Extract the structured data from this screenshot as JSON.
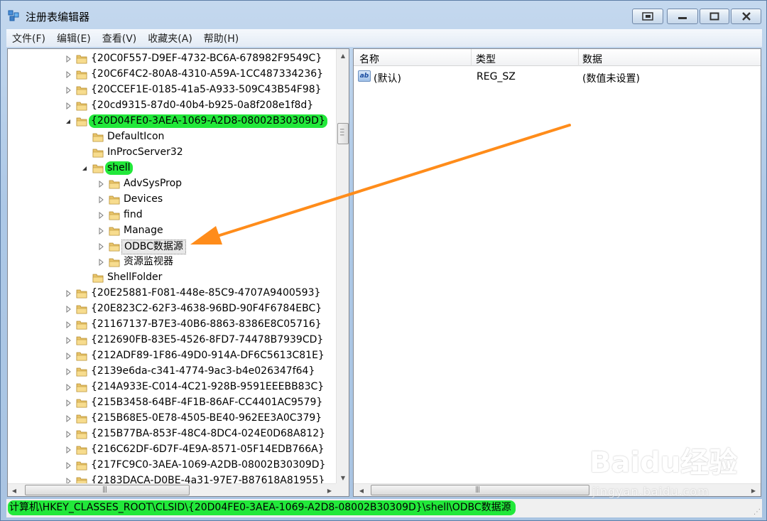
{
  "window": {
    "title": "注册表编辑器"
  },
  "menu": [
    "文件(F)",
    "编辑(E)",
    "查看(V)",
    "收藏夹(A)",
    "帮助(H)"
  ],
  "tree": {
    "rows": [
      {
        "label": "{20C0F557-D9EF-4732-BC6A-678982F9549C}",
        "level": 0,
        "state": "collapsed",
        "highlight": false,
        "selected": false
      },
      {
        "label": "{20C6F4C2-80A8-4310-A59A-1CC487334236}",
        "level": 0,
        "state": "collapsed",
        "highlight": false,
        "selected": false
      },
      {
        "label": "{20CCEF1E-0185-41a5-A933-509C43B54F98}",
        "level": 0,
        "state": "collapsed",
        "highlight": false,
        "selected": false
      },
      {
        "label": "{20cd9315-87d0-40b4-b925-0a8f208e1f8d}",
        "level": 0,
        "state": "collapsed",
        "highlight": false,
        "selected": false
      },
      {
        "label": "{20D04FE0-3AEA-1069-A2D8-08002B30309D}",
        "level": 0,
        "state": "expanded",
        "highlight": true,
        "selected": false
      },
      {
        "label": "DefaultIcon",
        "level": 1,
        "state": "none",
        "highlight": false,
        "selected": false
      },
      {
        "label": "InProcServer32",
        "level": 1,
        "state": "none",
        "highlight": false,
        "selected": false
      },
      {
        "label": "shell",
        "level": 1,
        "state": "expanded",
        "highlight": true,
        "selected": false
      },
      {
        "label": "AdvSysProp",
        "level": 2,
        "state": "collapsed",
        "highlight": false,
        "selected": false
      },
      {
        "label": "Devices",
        "level": 2,
        "state": "collapsed",
        "highlight": false,
        "selected": false
      },
      {
        "label": "find",
        "level": 2,
        "state": "collapsed",
        "highlight": false,
        "selected": false
      },
      {
        "label": "Manage",
        "level": 2,
        "state": "collapsed",
        "highlight": false,
        "selected": false
      },
      {
        "label": "ODBC数据源",
        "level": 2,
        "state": "collapsed",
        "highlight": false,
        "selected": true
      },
      {
        "label": "资源监视器",
        "level": 2,
        "state": "collapsed",
        "highlight": false,
        "selected": false
      },
      {
        "label": "ShellFolder",
        "level": 1,
        "state": "none",
        "highlight": false,
        "selected": false
      },
      {
        "label": "{20E25881-F081-448e-85C9-4707A9400593}",
        "level": 0,
        "state": "collapsed",
        "highlight": false,
        "selected": false
      },
      {
        "label": "{20E823C2-62F3-4638-96BD-90F4F6784EBC}",
        "level": 0,
        "state": "collapsed",
        "highlight": false,
        "selected": false
      },
      {
        "label": "{21167137-B7E3-40B6-8863-8386E8C05716}",
        "level": 0,
        "state": "collapsed",
        "highlight": false,
        "selected": false
      },
      {
        "label": "{212690FB-83E5-4526-8FD7-74478B7939CD}",
        "level": 0,
        "state": "collapsed",
        "highlight": false,
        "selected": false
      },
      {
        "label": "{212ADF89-1F86-49D0-914A-DF6C5613C81E}",
        "level": 0,
        "state": "collapsed",
        "highlight": false,
        "selected": false
      },
      {
        "label": "{2139e6da-c341-4774-9ac3-b4e026347f64}",
        "level": 0,
        "state": "collapsed",
        "highlight": false,
        "selected": false
      },
      {
        "label": "{214A933E-C014-4C21-928B-9591EEEBB83C}",
        "level": 0,
        "state": "collapsed",
        "highlight": false,
        "selected": false
      },
      {
        "label": "{215B3458-64BF-4F1B-86AF-CC4401AC9579}",
        "level": 0,
        "state": "collapsed",
        "highlight": false,
        "selected": false
      },
      {
        "label": "{215B68E5-0E78-4505-BE40-962EE3A0C379}",
        "level": 0,
        "state": "collapsed",
        "highlight": false,
        "selected": false
      },
      {
        "label": "{215B77BA-853F-48C4-8DC4-024E0D68A812}",
        "level": 0,
        "state": "collapsed",
        "highlight": false,
        "selected": false
      },
      {
        "label": "{216C62DF-6D7F-4E9A-8571-05F14EDB766A}",
        "level": 0,
        "state": "collapsed",
        "highlight": false,
        "selected": false
      },
      {
        "label": "{217FC9C0-3AEA-1069-A2DB-08002B30309D}",
        "level": 0,
        "state": "collapsed",
        "highlight": false,
        "selected": false
      },
      {
        "label": "{2183DACA-D0BE-4a31-97E7-B87618A81955}",
        "level": 0,
        "state": "collapsed",
        "highlight": false,
        "selected": false
      }
    ]
  },
  "values": {
    "headers": {
      "name": "名称",
      "type": "类型",
      "data": "数据"
    },
    "rows": [
      {
        "icon": "string-value-icon",
        "icon_text": "ab",
        "name": "(默认)",
        "type": "REG_SZ",
        "data": "(数值未设置)"
      }
    ]
  },
  "status": {
    "path": "计算机\\HKEY_CLASSES_ROOT\\CLSID\\{20D04FE0-3AEA-1069-A2D8-08002B30309D}\\shell\\ODBC数据源"
  },
  "watermark": {
    "brand": "Baidu经验",
    "site": "jingyan.baidu.com"
  },
  "colors": {
    "highlight": "#22e83a",
    "arrow": "#ff8c1a",
    "folder": "#e8c46a"
  }
}
